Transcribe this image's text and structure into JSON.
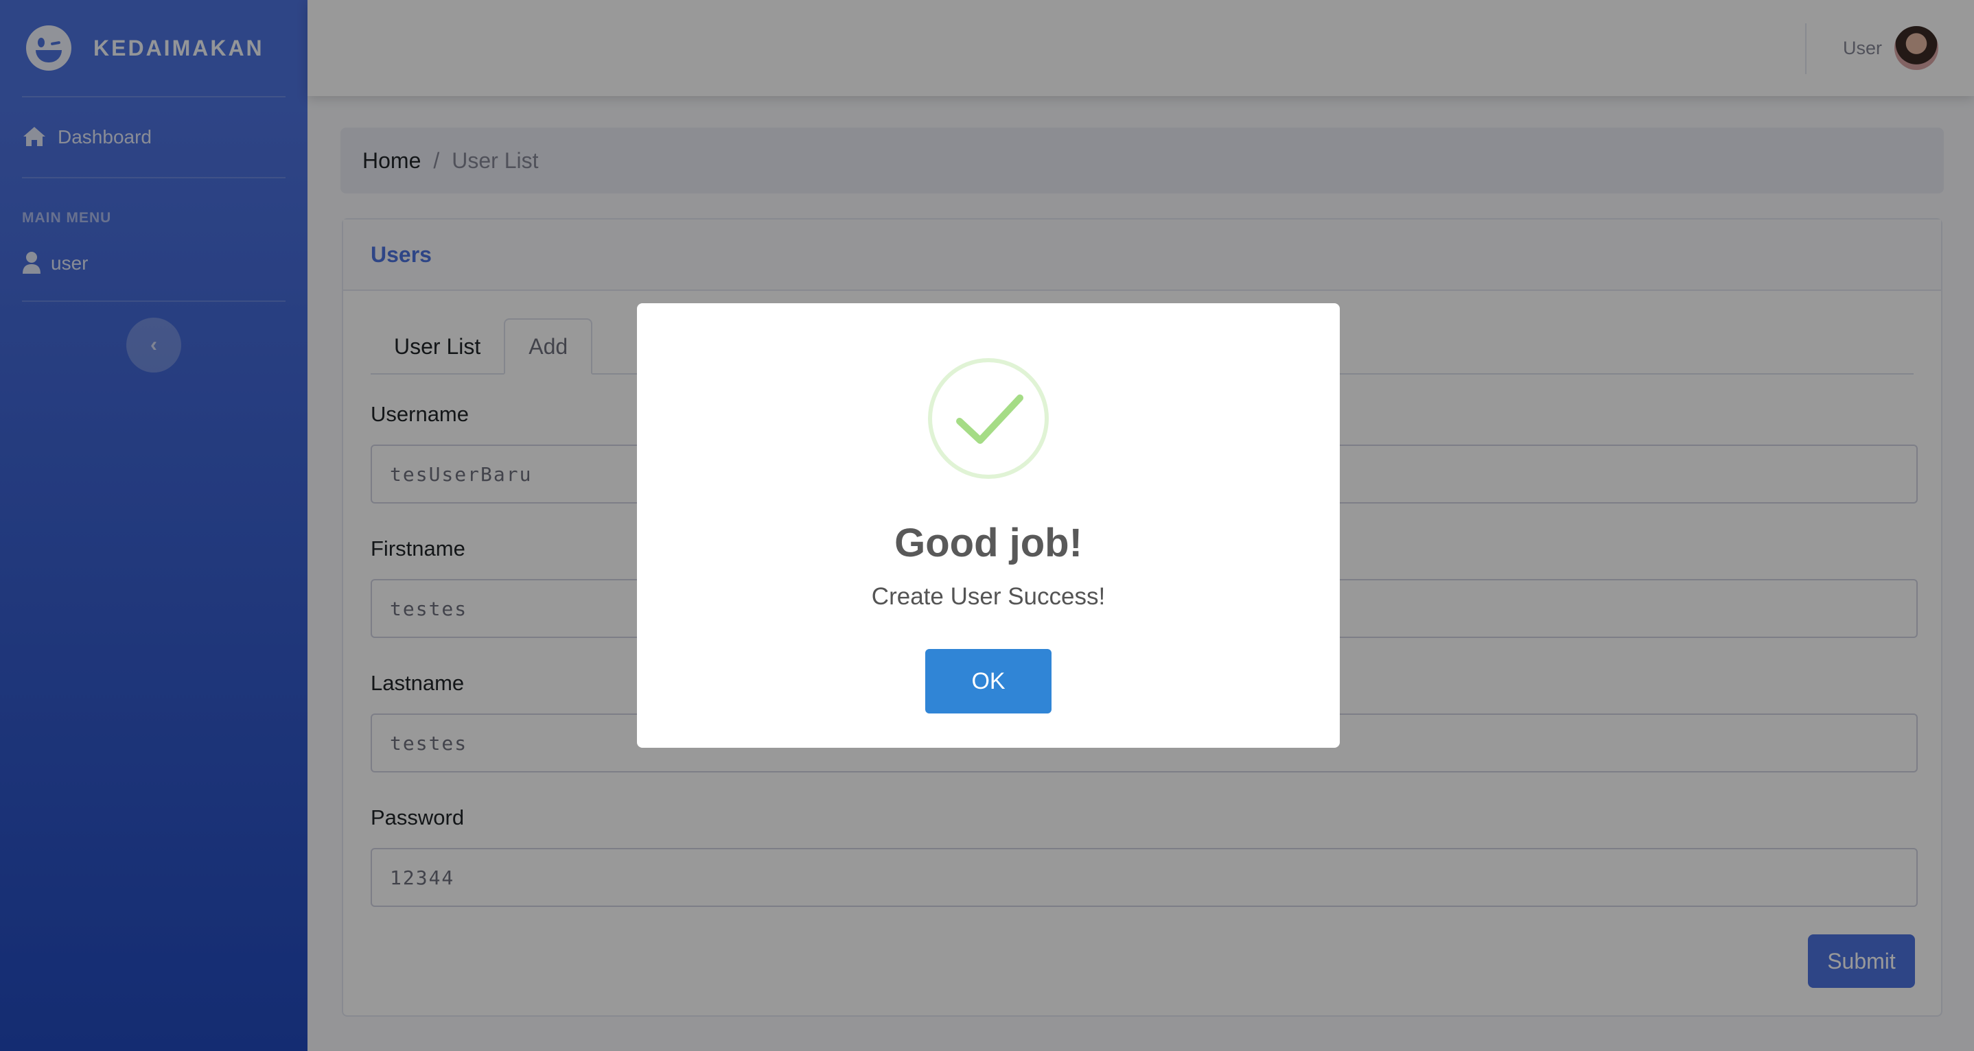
{
  "sidebar": {
    "brand": "KEDAIMAKAN",
    "dashboard_label": "Dashboard",
    "heading": "MAIN MENU",
    "user_label": "user",
    "toggle_icon": "chevron-left-icon"
  },
  "topbar": {
    "user_label": "User"
  },
  "breadcrumb": {
    "home": "Home",
    "separator": "/",
    "current": "User List"
  },
  "card": {
    "title": "Users",
    "tabs": [
      "User List",
      "Add"
    ],
    "fields": [
      {
        "label": "Username",
        "value": "tesUserBaru"
      },
      {
        "label": "Firstname",
        "value": "testes"
      },
      {
        "label": "Lastname",
        "value": "testes"
      },
      {
        "label": "Password",
        "value": "12344"
      }
    ],
    "submit_label": "Submit"
  },
  "modal": {
    "title": "Good job!",
    "text": "Create User Success!",
    "ok_label": "OK",
    "icon": "success-check-icon"
  },
  "colors": {
    "primary": "#4e73df",
    "sidebar_end": "#224abe",
    "ok_button": "#3085d6",
    "success": "#a5dc86"
  }
}
